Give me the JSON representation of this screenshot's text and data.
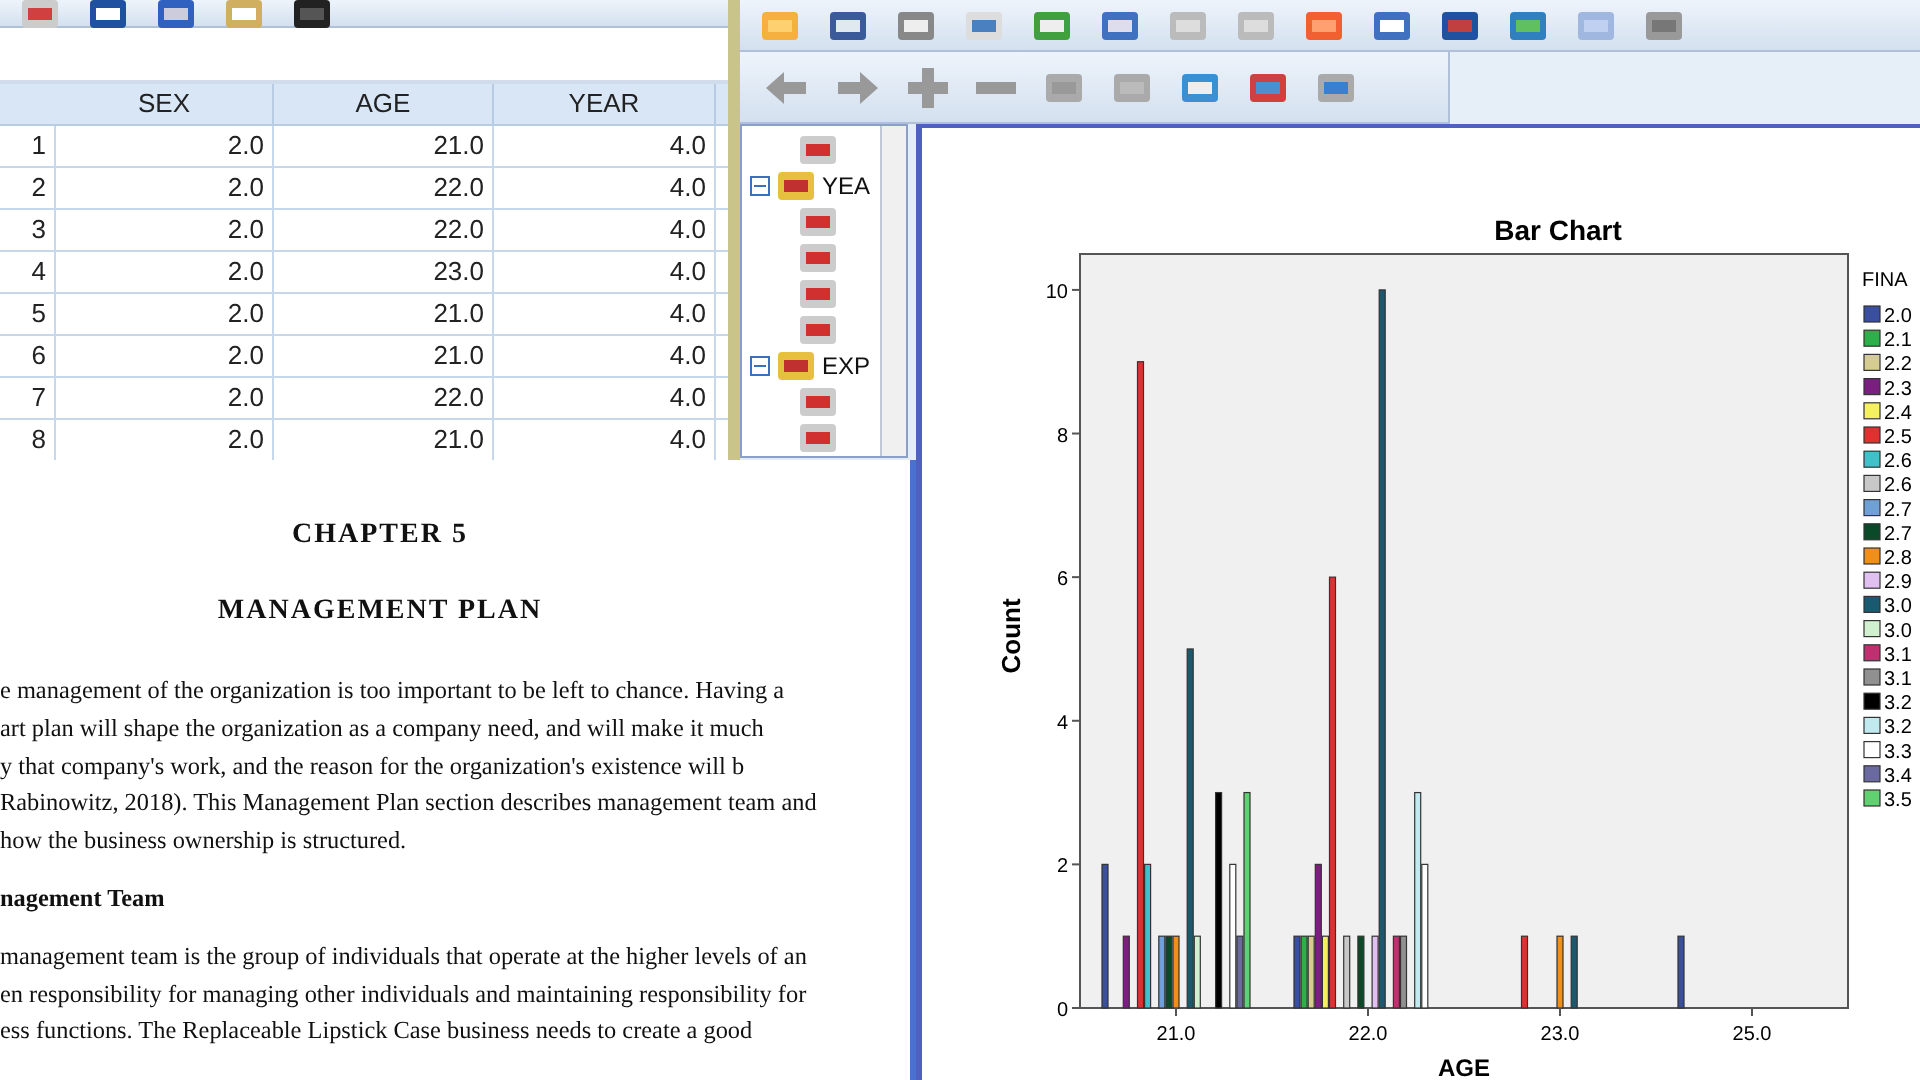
{
  "data_editor": {
    "columns": [
      "SEX",
      "AGE",
      "YEAR"
    ],
    "rows": [
      {
        "number": "1",
        "cells": [
          "2.0",
          "21.0",
          "4.0"
        ]
      },
      {
        "number": "2",
        "cells": [
          "2.0",
          "22.0",
          "4.0"
        ]
      },
      {
        "number": "3",
        "cells": [
          "2.0",
          "22.0",
          "4.0"
        ]
      },
      {
        "number": "4",
        "cells": [
          "2.0",
          "23.0",
          "4.0"
        ]
      },
      {
        "number": "5",
        "cells": [
          "2.0",
          "21.0",
          "4.0"
        ]
      },
      {
        "number": "6",
        "cells": [
          "2.0",
          "21.0",
          "4.0"
        ]
      },
      {
        "number": "7",
        "cells": [
          "2.0",
          "22.0",
          "4.0"
        ]
      },
      {
        "number": "8",
        "cells": [
          "2.0",
          "21.0",
          "4.0"
        ]
      }
    ]
  },
  "output_viewer": {
    "outline": [
      {
        "label": "YEA",
        "expanded": true
      },
      {
        "label": "EXP",
        "expanded": true
      }
    ],
    "chart_data": {
      "type": "bar",
      "title": "Bar Chart",
      "xlabel": "AGE",
      "ylabel": "Count",
      "legend": {
        "title": "FINA"
      },
      "categories": [
        "21.0",
        "22.0",
        "23.0",
        "25.0"
      ],
      "ylim": [
        0,
        10.5
      ],
      "yticks": [
        0,
        2,
        4,
        6,
        8,
        10
      ],
      "series": [
        {
          "name": "2.0",
          "color": "#3a4fa0",
          "values": [
            2,
            1,
            0,
            1
          ]
        },
        {
          "name": "2.1",
          "color": "#2db04a",
          "values": [
            0,
            1,
            0,
            0
          ]
        },
        {
          "name": "2.2",
          "color": "#d4cc90",
          "values": [
            0,
            1,
            0,
            0
          ]
        },
        {
          "name": "2.3",
          "color": "#7a1f80",
          "values": [
            1,
            2,
            0,
            0
          ]
        },
        {
          "name": "2.4",
          "color": "#f5f060",
          "values": [
            0,
            1,
            0,
            0
          ]
        },
        {
          "name": "2.5",
          "color": "#e03030",
          "values": [
            9,
            6,
            1,
            0
          ]
        },
        {
          "name": "2.6",
          "color": "#40c0c8",
          "values": [
            2,
            0,
            0,
            0
          ]
        },
        {
          "name": "2.6",
          "color": "#c8c8c8",
          "values": [
            0,
            1,
            0,
            0
          ]
        },
        {
          "name": "2.7",
          "color": "#70a0d8",
          "values": [
            1,
            0,
            0,
            0
          ]
        },
        {
          "name": "2.7",
          "color": "#0a4a28",
          "values": [
            1,
            1,
            0,
            0
          ]
        },
        {
          "name": "2.8",
          "color": "#f0901a",
          "values": [
            1,
            0,
            1,
            0
          ]
        },
        {
          "name": "2.9",
          "color": "#e0c0f0",
          "values": [
            0,
            1,
            0,
            0
          ]
        },
        {
          "name": "3.0",
          "color": "#1a5a70",
          "values": [
            5,
            10,
            1,
            0
          ]
        },
        {
          "name": "3.0",
          "color": "#d0f0d0",
          "values": [
            1,
            0,
            0,
            0
          ]
        },
        {
          "name": "3.1",
          "color": "#c03070",
          "values": [
            0,
            1,
            0,
            0
          ]
        },
        {
          "name": "3.1",
          "color": "#909090",
          "values": [
            0,
            1,
            0,
            0
          ]
        },
        {
          "name": "3.2",
          "color": "#000000",
          "values": [
            3,
            0,
            0,
            0
          ]
        },
        {
          "name": "3.2",
          "color": "#c0eaf0",
          "values": [
            0,
            3,
            0,
            0
          ]
        },
        {
          "name": "3.3",
          "color": "#ffffff",
          "values": [
            2,
            2,
            0,
            0
          ]
        },
        {
          "name": "3.4",
          "color": "#6a6aa0",
          "values": [
            1,
            0,
            0,
            0
          ]
        },
        {
          "name": "3.5",
          "color": "#60d070",
          "values": [
            3,
            0,
            0,
            0
          ]
        }
      ]
    }
  },
  "document": {
    "chapter": "CHAPTER 5",
    "title": "MANAGEMENT PLAN",
    "blocks": [
      {
        "kind": "paragraph",
        "lines": [
          "e management of the organization is too important to be left to chance. Having a",
          "art plan will shape the organization as a company need, and will make it much",
          "y that company's work, and the reason for the organization's existence will b",
          "Rabinowitz, 2018). This Management Plan section describes management team and",
          "how the business ownership is structured."
        ]
      },
      {
        "kind": "heading",
        "lines": [
          "nagement Team"
        ]
      },
      {
        "kind": "paragraph",
        "lines": [
          "management team is the group of individuals that operate at the higher levels of an",
          "en responsibility for managing other individuals and maintaining responsibility for",
          "ess functions. The Replaceable Lipstick Case business needs to create a good"
        ]
      }
    ]
  }
}
